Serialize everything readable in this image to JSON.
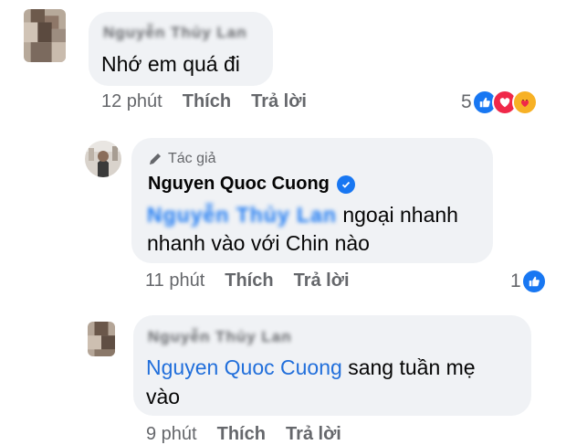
{
  "comments": [
    {
      "author": "Nguyễn Thủy Lan",
      "text": "Nhớ em quá đi",
      "time": "12 phút",
      "like_label": "Thích",
      "reply_label": "Trả lời",
      "reaction_count": "5",
      "reactions": [
        "like-icon",
        "love-icon",
        "care-icon"
      ]
    },
    {
      "badge": "Tác giả",
      "author": "Nguyen Quoc Cuong",
      "mention": "Nguyễn Thủy Lan",
      "text_after_mention": "ngoại nhanh",
      "text_line2": "nhanh vào với Chin nào",
      "time": "11 phút",
      "like_label": "Thích",
      "reply_label": "Trả lời",
      "reaction_count": "1",
      "reactions": [
        "like-icon"
      ]
    },
    {
      "author": "Nguyễn Thủy Lan",
      "mention": "Nguyen Quoc Cuong",
      "text_after_mention": "sang tuần mẹ",
      "text_line2": "vào",
      "time": "9 phút",
      "like_label": "Thích",
      "reply_label": "Trả lời"
    }
  ],
  "colors": {
    "bubble": "#f0f2f5",
    "meta": "#65676b",
    "mention": "#216fdb",
    "like": "#1877f2",
    "love": "#f02849",
    "care": "#f7b125"
  }
}
